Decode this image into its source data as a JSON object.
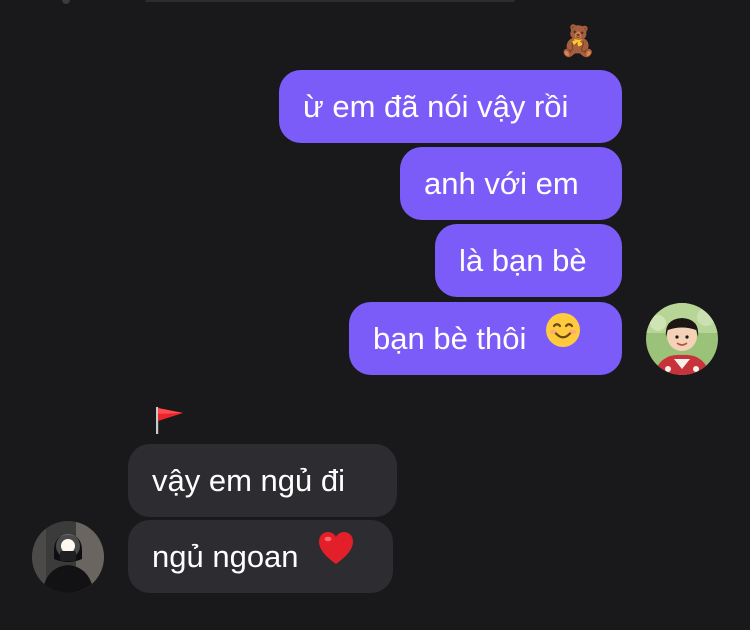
{
  "conversation": {
    "outgoing_reaction_icon": "teddy-bear-icon",
    "outgoing_reaction_emoji": "🧸",
    "incoming_reaction_icon": "red-flag-icon",
    "messages_out": [
      {
        "text": "ừ em đã nói vậy rồi"
      },
      {
        "text": "anh với em"
      },
      {
        "text": "là bạn bè"
      },
      {
        "text": "bạn bè thôi",
        "emoji": "😊",
        "emoji_icon": "smiling-face-icon"
      }
    ],
    "messages_in": [
      {
        "text": "vậy em ngủ đi"
      },
      {
        "text": "ngủ ngoan",
        "emoji": "❤️",
        "emoji_icon": "red-heart-icon"
      }
    ]
  },
  "colors": {
    "background": "#19181b",
    "outgoing_bubble": "#7b5cf8",
    "incoming_bubble": "#2d2c30",
    "text": "#ffffff"
  }
}
